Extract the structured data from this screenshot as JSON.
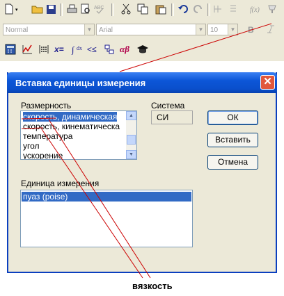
{
  "toolbar": {
    "style_combo": "Normal",
    "font_combo": "Arial",
    "size_combo": "10",
    "bold_label": "B",
    "row1_icons": [
      "new-document-icon",
      "open-folder-icon",
      "save-icon",
      "print-icon",
      "print-preview-icon",
      "spellcheck-icon",
      "cut-icon",
      "copy-icon",
      "paste-icon",
      "undo-icon",
      "redo-icon",
      "insert-table-icon",
      "columns-icon",
      "style-icon",
      "format-painter-icon"
    ],
    "row3_icons": [
      "calculator-icon",
      "graph-icon",
      "matrix-icon",
      "evaluate-icon",
      "calculus-icon",
      "boolean-icon",
      "programming-icon",
      "greek-icon",
      "symbolic-icon"
    ],
    "eval_label": "x=",
    "greek_label": "αβ"
  },
  "dialog": {
    "title": "Вставка единицы измерения",
    "dimension_label": "Размерность",
    "dimension_items": [
      "скорость, динамическая",
      "скорость, кинематическа",
      "температура",
      "угол",
      "ускорение"
    ],
    "dimension_selected_index": 0,
    "system_label": "Система",
    "system_value": "СИ",
    "ok_label": "ОК",
    "insert_label": "Вставить",
    "cancel_label": "Отмена",
    "unit_label": "Единица измерения",
    "unit_items": [
      "пуаз (poise)"
    ],
    "close_glyph": "✕"
  },
  "annotation": {
    "caption": "вязкость",
    "line_color": "#cc0000"
  },
  "colors": {
    "selection": "#316ac5",
    "titlebar": "#0a4fcc",
    "dialog_face": "#ece9d8"
  }
}
